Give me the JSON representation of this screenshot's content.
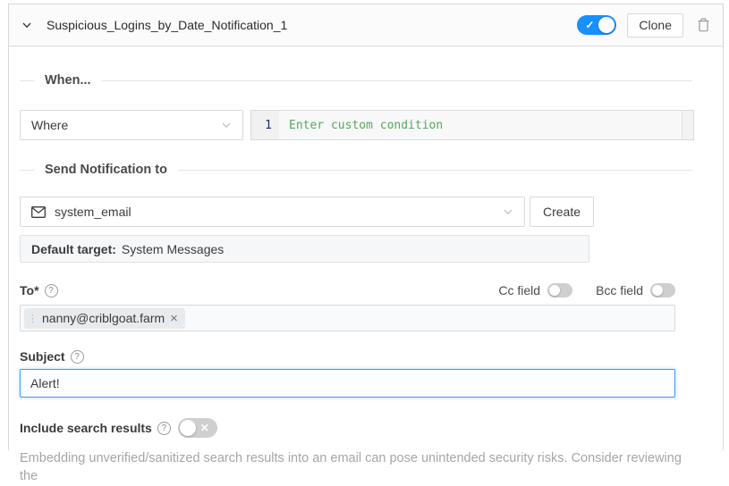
{
  "colors": {
    "accent": "#1890ff",
    "focus_border": "#3f9bfc",
    "editor_placeholder_green": "#57a75d",
    "editor_line_number_navy": "#1e2a78",
    "border_gray": "#d9d9d9",
    "muted_text": "#a6a6a6"
  },
  "icons": {
    "check": "✓",
    "close": "✕",
    "help": "?",
    "drag": "⋮",
    "remove": "×"
  },
  "header": {
    "title": "Suspicious_Logins_by_Date_Notification_1",
    "clone_label": "Clone",
    "enabled": true
  },
  "when_section": {
    "title": "When...",
    "operator": "Where",
    "line_number": "1",
    "condition_placeholder": "Enter custom condition"
  },
  "send_section": {
    "title": "Send Notification to",
    "target_selected": "system_email",
    "create_label": "Create",
    "default_target_label": "Default target:",
    "default_target_value": "System Messages"
  },
  "recipients": {
    "to_label": "To*",
    "to_tag": "nanny@criblgoat.farm",
    "cc_label": "Cc field",
    "cc_enabled": false,
    "bcc_label": "Bcc field",
    "bcc_enabled": false
  },
  "subject": {
    "label": "Subject",
    "value": "Alert!"
  },
  "include_results": {
    "label": "Include search results",
    "enabled": false
  },
  "warning": "Embedding unverified/sanitized search results into an email can pose unintended security risks. Consider reviewing the"
}
